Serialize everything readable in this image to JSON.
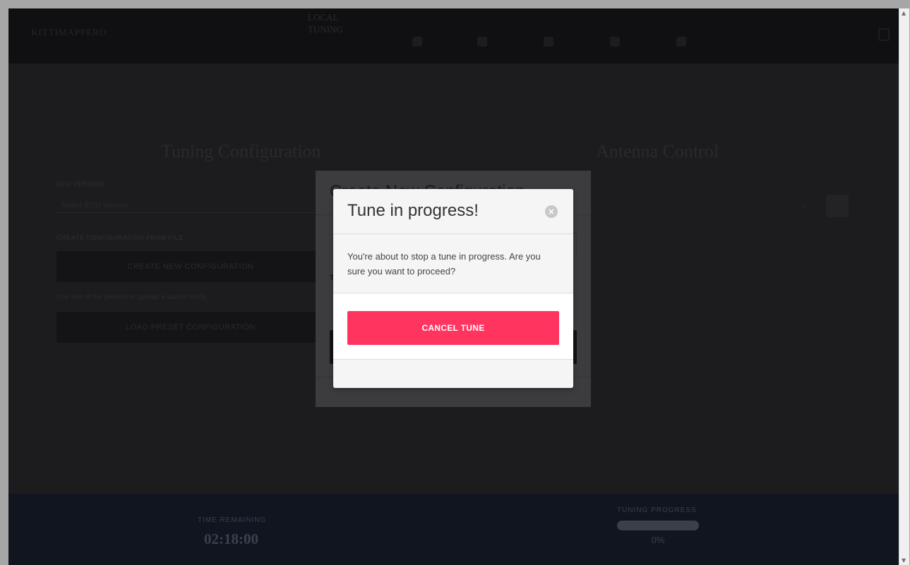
{
  "app": {
    "logo": "KITTIMAPPERO",
    "nav_title_line1": "LOCAL",
    "nav_title_line2": "TUNING",
    "nav_icons": [
      "gear-icon",
      "user-icon",
      "chart-icon",
      "info-icon",
      "globe-icon"
    ]
  },
  "page": {
    "tuning_title": "Tuning Configuration",
    "antenna_title": "Antenna Control",
    "ecu_label": "ECU VERSION",
    "ecu_select_value": "Select ECU version",
    "create_label": "CREATE CONFIGURATION FROM FILE",
    "create_button": "CREATE NEW CONFIGURATION",
    "hint": "Use one of the presets or upload a saved config",
    "load_button": "LOAD PRESET CONFIGURATION",
    "antenna_select_icon": "chevron-down-icon"
  },
  "background_modal": {
    "title": "Create New Configuration",
    "field_letter": "T"
  },
  "modal": {
    "title": "Tune in progress!",
    "message": "You're about to stop a tune in progress. Are you sure you want to proceed?",
    "cancel_button": "CANCEL TUNE",
    "close_icon": "close-icon"
  },
  "status": {
    "time_label": "TIME REMAINING",
    "time_value": "02:18:00",
    "progress_label": "TUNING PROGRESS",
    "progress_text": "0%",
    "progress_fraction": 0
  },
  "colors": {
    "accent": "#ff3560",
    "overlay_background": "#1c1c1f",
    "modal_background": "#ffffff"
  }
}
